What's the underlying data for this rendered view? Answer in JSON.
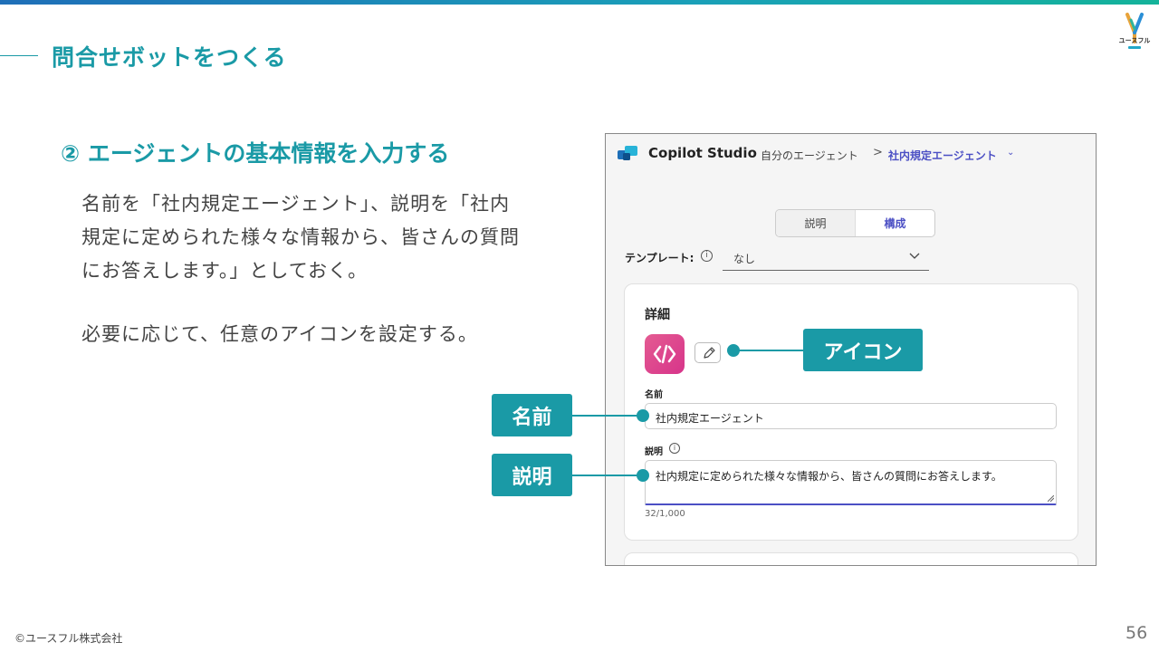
{
  "header": {
    "title": "問合せボットをつくる",
    "logo_text": "ユースフル"
  },
  "step": {
    "heading": "② エージェントの基本情報を入力する",
    "paragraph1": "名前を「社内規定エージェント」、説明を「社内規定に定められた様々な情報から、皆さんの質問にお答えします。」としておく。",
    "paragraph2": "必要に応じて、任意のアイコンを設定する。"
  },
  "screenshot": {
    "app_name": "Copilot Studio",
    "breadcrumb_parent": "自分のエージェント",
    "breadcrumb_separator": ">",
    "breadcrumb_current": "社内規定エージェント",
    "tabs": [
      {
        "label": "説明",
        "active": false
      },
      {
        "label": "構成",
        "active": true
      }
    ],
    "template_label": "テンプレート:",
    "template_value": "なし",
    "details_title": "詳細",
    "name_label": "名前",
    "name_value": "社内規定エージェント",
    "description_label": "説明",
    "description_value": "社内規定に定められた様々な情報から、皆さんの質問にお答えします。",
    "char_counter": "32/1,000",
    "accent_color": "#4b4fc4"
  },
  "callouts": {
    "icon": "アイコン",
    "name": "名前",
    "description": "説明",
    "color": "#1a9aa6"
  },
  "footer": {
    "copyright": "©ユースフル株式会社",
    "page_number": "56"
  }
}
